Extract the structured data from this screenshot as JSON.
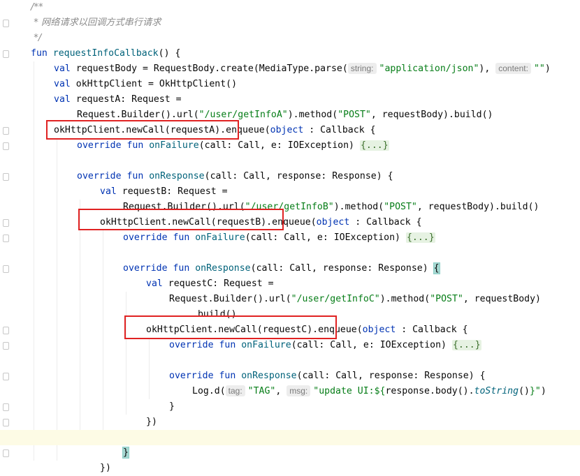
{
  "editor": {
    "lines": [
      {
        "indent": 0,
        "text": "/**",
        "type": "comment"
      },
      {
        "indent": 0,
        "text": " * 网络请求以回调方式串行请求",
        "type": "comment"
      },
      {
        "indent": 0,
        "text": " */",
        "type": "comment"
      },
      {
        "indent": 0,
        "parts": [
          [
            "kw",
            "fun "
          ],
          [
            "fn",
            "requestInfoCallback"
          ],
          [
            "",
            "() {"
          ]
        ]
      },
      {
        "indent": 1,
        "parts": [
          [
            "kw",
            "val "
          ],
          [
            "",
            "requestBody = RequestBody.create(MediaType.parse("
          ],
          [
            "hint",
            "string:"
          ],
          [
            "str",
            "\"application/json\""
          ],
          [
            "",
            "), "
          ],
          [
            "hint",
            "content:"
          ],
          [
            "str",
            "\"\""
          ],
          [
            "",
            ")"
          ]
        ]
      },
      {
        "indent": 1,
        "parts": [
          [
            "kw",
            "val "
          ],
          [
            "",
            "okHttpClient = OkHttpClient()"
          ]
        ]
      },
      {
        "indent": 1,
        "parts": [
          [
            "kw",
            "val "
          ],
          [
            "",
            "requestA: Request ="
          ]
        ]
      },
      {
        "indent": 2,
        "parts": [
          [
            "",
            "Request.Builder().url("
          ],
          [
            "str",
            "\"/user/getInfoA\""
          ],
          [
            "",
            ").method("
          ],
          [
            "str",
            "\"POST\""
          ],
          [
            "",
            ", requestBody).build()"
          ]
        ]
      },
      {
        "indent": 1,
        "parts": [
          [
            "",
            "okHttpClient.newCall(requestA).enqueue("
          ],
          [
            "kw",
            "object "
          ],
          [
            "",
            ": Callback {"
          ]
        ]
      },
      {
        "indent": 2,
        "parts": [
          [
            "kw",
            "override fun "
          ],
          [
            "fn",
            "onFailure"
          ],
          [
            "",
            "(call: Call, e: IOException) "
          ],
          [
            "folded",
            "{...}"
          ]
        ]
      },
      {
        "indent": 0,
        "parts": [
          [
            "",
            ""
          ]
        ]
      },
      {
        "indent": 2,
        "parts": [
          [
            "kw",
            "override fun "
          ],
          [
            "fn",
            "onResponse"
          ],
          [
            "",
            "(call: Call, response: Response) {"
          ]
        ]
      },
      {
        "indent": 3,
        "parts": [
          [
            "kw",
            "val "
          ],
          [
            "",
            "requestB: Request ="
          ]
        ]
      },
      {
        "indent": 4,
        "parts": [
          [
            "",
            "Request.Builder().url("
          ],
          [
            "str",
            "\"/user/getInfoB\""
          ],
          [
            "",
            ").method("
          ],
          [
            "str",
            "\"POST\""
          ],
          [
            "",
            ", requestBody).build()"
          ]
        ]
      },
      {
        "indent": 3,
        "parts": [
          [
            "",
            "okHttpClient.newCall(requestB).enqueue("
          ],
          [
            "kw",
            "object "
          ],
          [
            "",
            ": Callback {"
          ]
        ]
      },
      {
        "indent": 4,
        "parts": [
          [
            "kw",
            "override fun "
          ],
          [
            "fn",
            "onFailure"
          ],
          [
            "",
            "(call: Call, e: IOException) "
          ],
          [
            "folded",
            "{...}"
          ]
        ]
      },
      {
        "indent": 0,
        "parts": [
          [
            "",
            ""
          ]
        ]
      },
      {
        "indent": 4,
        "parts": [
          [
            "kw",
            "override fun "
          ],
          [
            "fn",
            "onResponse"
          ],
          [
            "",
            "(call: Call, response: Response) "
          ],
          [
            "brace",
            "{"
          ]
        ]
      },
      {
        "indent": 5,
        "parts": [
          [
            "kw",
            "val "
          ],
          [
            "",
            "requestC: Request ="
          ]
        ]
      },
      {
        "indent": 6,
        "parts": [
          [
            "",
            "Request.Builder().url("
          ],
          [
            "str",
            "\"/user/getInfoC\""
          ],
          [
            "",
            ").method("
          ],
          [
            "str",
            "\"POST\""
          ],
          [
            "",
            ", requestBody)"
          ]
        ]
      },
      {
        "indent": 7,
        "parts": [
          [
            "",
            ".build()"
          ]
        ]
      },
      {
        "indent": 5,
        "parts": [
          [
            "",
            "okHttpClient.newCall(requestC).enqueue("
          ],
          [
            "kw",
            "object "
          ],
          [
            "",
            ": Callback {"
          ]
        ]
      },
      {
        "indent": 6,
        "parts": [
          [
            "kw",
            "override fun "
          ],
          [
            "fn",
            "onFailure"
          ],
          [
            "",
            "(call: Call, e: IOException) "
          ],
          [
            "folded",
            "{...}"
          ]
        ]
      },
      {
        "indent": 0,
        "parts": [
          [
            "",
            ""
          ]
        ]
      },
      {
        "indent": 6,
        "parts": [
          [
            "kw",
            "override fun "
          ],
          [
            "fn",
            "onResponse"
          ],
          [
            "",
            "(call: Call, response: Response) {"
          ]
        ]
      },
      {
        "indent": 7,
        "parts": [
          [
            "",
            "Log.d("
          ],
          [
            "hint",
            "tag:"
          ],
          [
            "str",
            "\"TAG\""
          ],
          [
            "",
            ", "
          ],
          [
            "hint",
            "msg:"
          ],
          [
            "str",
            "\"update UI:${"
          ],
          [
            "",
            "response.body()."
          ],
          [
            "it",
            "toString"
          ],
          [
            "",
            "()"
          ],
          [
            "str",
            "}\""
          ],
          [
            "",
            ")"
          ]
        ]
      },
      {
        "indent": 6,
        "parts": [
          [
            "",
            "}"
          ]
        ]
      },
      {
        "indent": 5,
        "parts": [
          [
            "",
            "})"
          ]
        ]
      },
      {
        "indent": 0,
        "parts": [
          [
            "",
            ""
          ]
        ]
      },
      {
        "indent": 4,
        "parts": [
          [
            "brace",
            "}"
          ]
        ]
      },
      {
        "indent": 3,
        "parts": [
          [
            "",
            "})"
          ]
        ]
      }
    ],
    "highlighted_line": 28
  }
}
